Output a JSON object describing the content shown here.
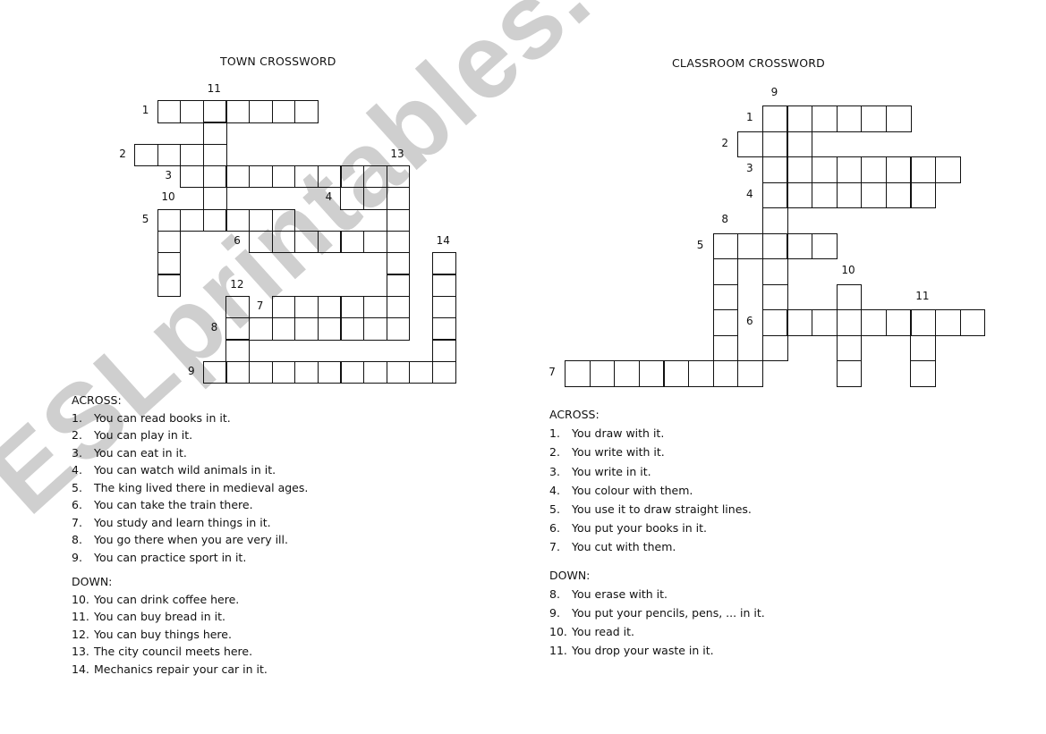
{
  "watermark": "ESLprintables.com",
  "town": {
    "title": "TOWN CROSSWORD",
    "numbers": [
      {
        "label": "11",
        "r": -1,
        "c": 3
      },
      {
        "label": "1",
        "r": 0,
        "c": 0
      },
      {
        "label": "2",
        "r": 2,
        "c": -1
      },
      {
        "label": "13",
        "r": 2,
        "c": 11
      },
      {
        "label": "3",
        "r": 3,
        "c": 1
      },
      {
        "label": "10",
        "r": 4,
        "c": 1
      },
      {
        "label": "4",
        "r": 4,
        "c": 8
      },
      {
        "label": "5",
        "r": 5,
        "c": 0
      },
      {
        "label": "6",
        "r": 6,
        "c": 4
      },
      {
        "label": "14",
        "r": 6,
        "c": 13
      },
      {
        "label": "12",
        "r": 8,
        "c": 4
      },
      {
        "label": "7",
        "r": 9,
        "c": 5
      },
      {
        "label": "8",
        "r": 10,
        "c": 3
      },
      {
        "label": "9",
        "r": 12,
        "c": 2
      }
    ],
    "across_header": "ACROSS:",
    "across": [
      {
        "n": "1.",
        "text": "You can read books in it."
      },
      {
        "n": "2.",
        "text": "You can play in it."
      },
      {
        "n": "3.",
        "text": "You can eat in it."
      },
      {
        "n": "4.",
        "text": "You can watch wild animals in it."
      },
      {
        "n": "5.",
        "text": "The king lived there in medieval ages."
      },
      {
        "n": "6.",
        "text": "You can take the train there."
      },
      {
        "n": "7.",
        "text": "You study and learn things in it."
      },
      {
        "n": "8.",
        "text": "You go there when you are very ill."
      },
      {
        "n": "9.",
        "text": "You can practice sport in it."
      }
    ],
    "down_header": "DOWN:",
    "down": [
      {
        "n": "10.",
        "text": "You can drink coffee here."
      },
      {
        "n": "11.",
        "text": "You can buy bread in it."
      },
      {
        "n": "12.",
        "text": "You can buy things here."
      },
      {
        "n": "13.",
        "text": "The city council meets here."
      },
      {
        "n": "14.",
        "text": "Mechanics repair your car in it."
      }
    ]
  },
  "classroom": {
    "title": "CLASSROOM CROSSWORD",
    "numbers": [
      {
        "label": "9",
        "r": -1,
        "c": 8
      },
      {
        "label": "1",
        "r": 0,
        "c": 7
      },
      {
        "label": "2",
        "r": 1,
        "c": 6
      },
      {
        "label": "3",
        "r": 2,
        "c": 7
      },
      {
        "label": "4",
        "r": 3,
        "c": 7
      },
      {
        "label": "8",
        "r": 4,
        "c": 6
      },
      {
        "label": "5",
        "r": 5,
        "c": 5
      },
      {
        "label": "10",
        "r": 6,
        "c": 11
      },
      {
        "label": "11",
        "r": 7,
        "c": 14
      },
      {
        "label": "6",
        "r": 8,
        "c": 7
      },
      {
        "label": "7",
        "r": 10,
        "c": -1
      }
    ],
    "across_header": "ACROSS:",
    "across": [
      {
        "n": "1.",
        "text": "You draw with it."
      },
      {
        "n": "2.",
        "text": "You write with it."
      },
      {
        "n": "3.",
        "text": "You write in it."
      },
      {
        "n": "4.",
        "text": "You colour with them."
      },
      {
        "n": "5.",
        "text": "You use it to draw straight lines."
      },
      {
        "n": "6.",
        "text": "You put your books in it."
      },
      {
        "n": "7.",
        "text": "You cut with them."
      }
    ],
    "down_header": "DOWN:",
    "down": [
      {
        "n": "8.",
        "text": "You erase with it."
      },
      {
        "n": "9.",
        "text": "You put your pencils, pens, ... in it."
      },
      {
        "n": "10.",
        "text": "You read it."
      },
      {
        "n": "11.",
        "text": "You drop your waste in it."
      }
    ]
  }
}
